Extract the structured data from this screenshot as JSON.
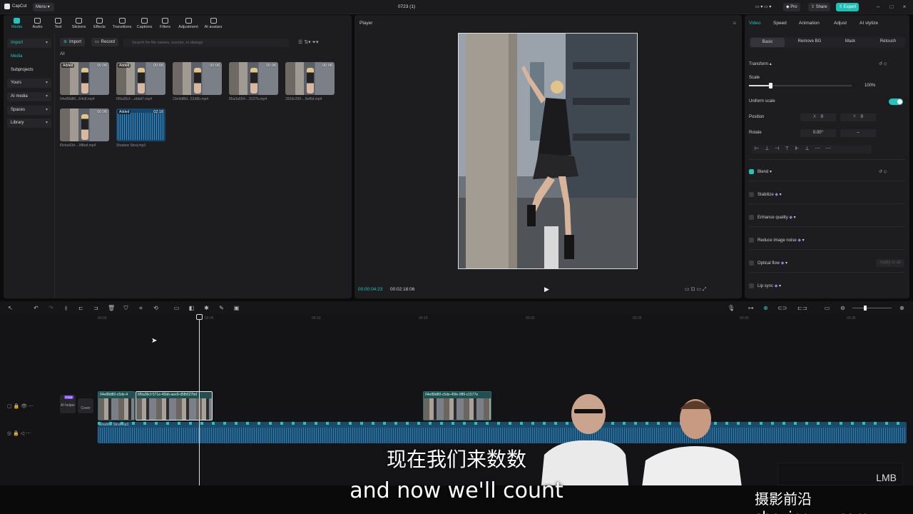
{
  "topbar": {
    "app_name": "CapCut",
    "menu": "Menu",
    "title": "0723 (1)",
    "pro": "Pro",
    "share": "Share",
    "export": "Export"
  },
  "media_tabs": [
    "Media",
    "Audio",
    "Text",
    "Stickers",
    "Effects",
    "Transitions",
    "Captions",
    "Filters",
    "Adjustment",
    "AI avatars"
  ],
  "media_side": {
    "import": "Import",
    "media": "Media",
    "subprojects": "Subprojects",
    "yours": "Yours",
    "ai_media": "AI media",
    "spaces": "Spaces",
    "library": "Library"
  },
  "media_toolbar": {
    "import": "Import",
    "record": "Record",
    "search_placeholder": "Search for file names, scenes, or dialogs",
    "all": "All"
  },
  "clips": [
    {
      "name": "04e88d80...64e8.mp4",
      "duration": "00:06",
      "added": "Added"
    },
    {
      "name": "6f9a36cf-...ebbd7.mp4",
      "duration": "00:06",
      "added": "Added"
    },
    {
      "name": "23e9df8d...52d5b.mp4",
      "duration": "00:06",
      "added": ""
    },
    {
      "name": "85a3a594-...9127b.mp4",
      "duration": "00:06",
      "added": ""
    },
    {
      "name": "292dc299-...9ef6d.mp4",
      "duration": "00:06",
      "added": ""
    },
    {
      "name": "f0eba43d-...98baf.mp4",
      "duration": "00:06",
      "added": ""
    },
    {
      "name": "Shadow Strut.mp3",
      "duration": "02:18",
      "added": "Added"
    }
  ],
  "player": {
    "title": "Player",
    "current_time": "00:00:04:23",
    "total_time": "00:02:18:06"
  },
  "props": {
    "tabs": [
      "Video",
      "Speed",
      "Animation",
      "Adjust",
      "AI stylize"
    ],
    "subtabs": [
      "Basic",
      "Remove BG",
      "Mask",
      "Retouch"
    ],
    "transform": "Transform",
    "scale": "Scale",
    "scale_value": "100%",
    "uniform_scale": "Uniform scale",
    "position": "Position",
    "pos_x_label": "X",
    "pos_x": "0",
    "pos_y_label": "Y",
    "pos_y": "0",
    "rotate": "Rotate",
    "rotate_value": "0.00°",
    "rotate_dash": "–",
    "blend": "Blend",
    "stabilize": "Stabilize",
    "enhance_quality": "Enhance quality",
    "reduce_noise": "Reduce image noise",
    "optical_flow": "Optical flow",
    "apply_all": "Apply to all",
    "lip_sync": "Lip sync"
  },
  "timeline": {
    "ticks": [
      "00:00",
      "00:05",
      "00:10",
      "00:15",
      "00:20",
      "00:25",
      "00:30",
      "00:35",
      "00:40"
    ],
    "clip1_label": "04e88d80-c5de-4",
    "clip2_label": "6f9a36cf-571e-45bb-aee9-d5fb527bd",
    "clip3_label": "04e88d80-c5de-45fe-9ff9-c1577e",
    "audio_label": "Shadow Strut.mp3",
    "free_badge": "Free",
    "ai_label": "AI helper",
    "cover_label": "Cover"
  },
  "overlay": {
    "subtitle_cn": "现在我们来数数",
    "subtitle_en": "and now we'll count",
    "watermark": "摄影前沿 sheyingzyz.com",
    "lmb": "LMB"
  },
  "colors": {
    "accent": "#20c6bd",
    "panel": "#1d1d20",
    "audio": "#1b4a6b"
  }
}
